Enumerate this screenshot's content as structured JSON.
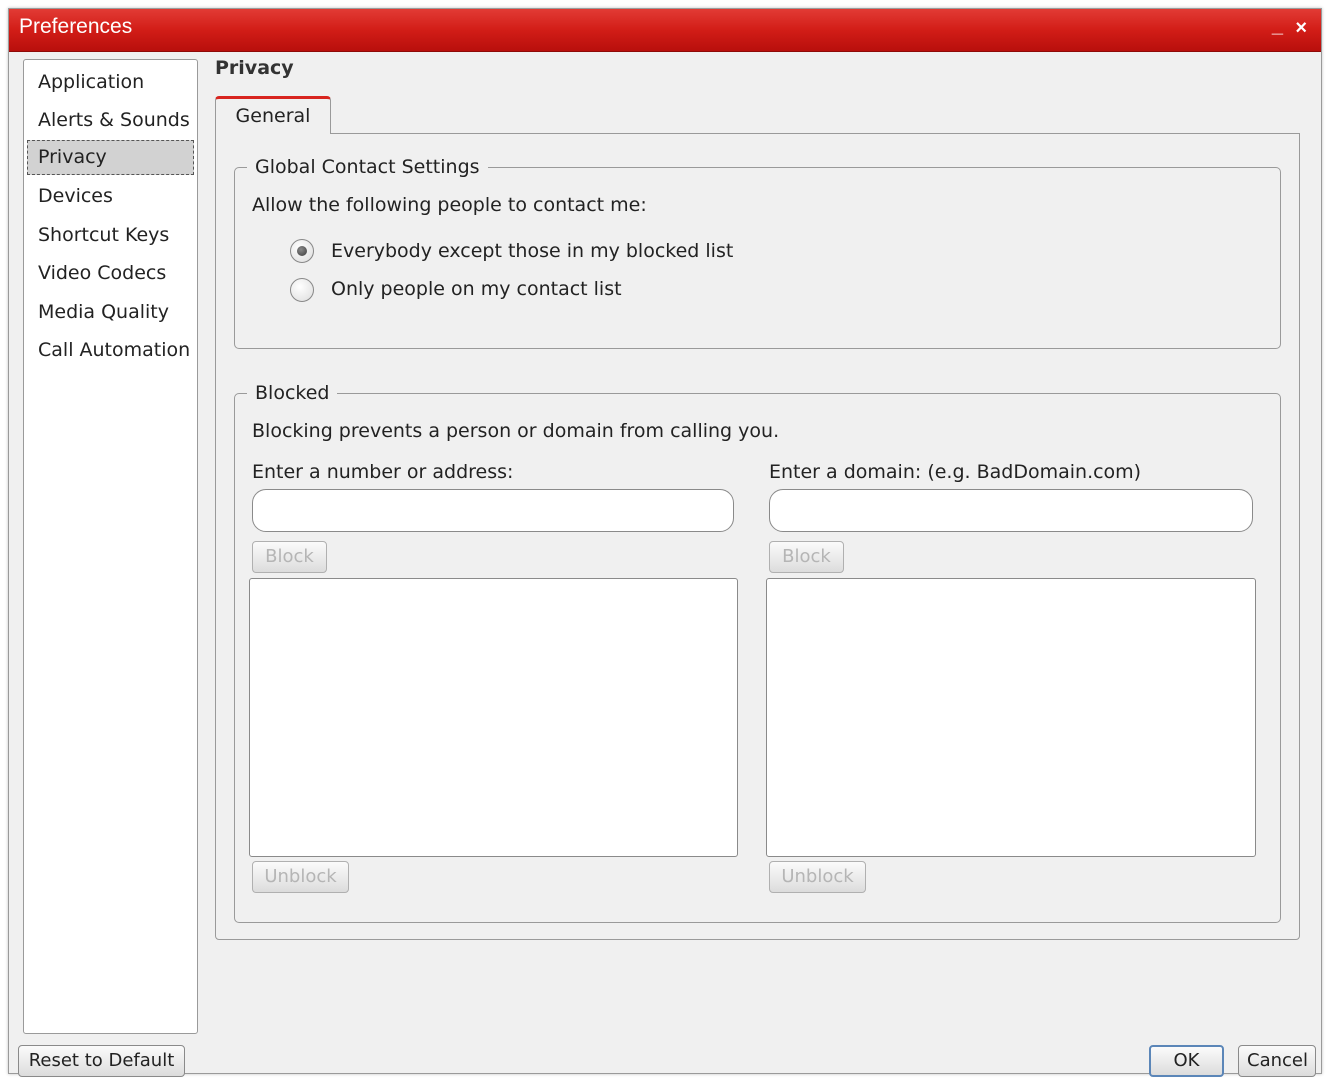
{
  "window": {
    "title": "Preferences",
    "minimize_glyph": "_",
    "close_glyph": "×"
  },
  "sidebar": {
    "items": [
      {
        "label": "Application"
      },
      {
        "label": "Alerts & Sounds"
      },
      {
        "label": "Privacy",
        "selected": true
      },
      {
        "label": "Devices"
      },
      {
        "label": "Shortcut Keys"
      },
      {
        "label": "Video Codecs"
      },
      {
        "label": "Media Quality"
      },
      {
        "label": "Call Automation"
      }
    ]
  },
  "page": {
    "title": "Privacy",
    "tabs": [
      {
        "label": "General",
        "active": true
      }
    ]
  },
  "global_contact": {
    "legend": "Global Contact Settings",
    "prompt": "Allow the following people to contact me:",
    "options": [
      {
        "label": "Everybody except those in my blocked list",
        "checked": true
      },
      {
        "label": "Only people on my contact list",
        "checked": false
      }
    ]
  },
  "blocked": {
    "legend": "Blocked",
    "description": "Blocking prevents a person or domain from calling you.",
    "number": {
      "label": "Enter a number or address:",
      "value": "",
      "block_label": "Block",
      "unblock_label": "Unblock"
    },
    "domain": {
      "label": "Enter a domain: (e.g. BadDomain.com)",
      "value": "",
      "block_label": "Block",
      "unblock_label": "Unblock"
    }
  },
  "footer": {
    "reset_label": "Reset to Default",
    "ok_label": "OK",
    "cancel_label": "Cancel"
  },
  "colors": {
    "titlebar": "#d21d17",
    "tab_accent": "#d8251f",
    "selected_item": "#d2d2d2"
  }
}
